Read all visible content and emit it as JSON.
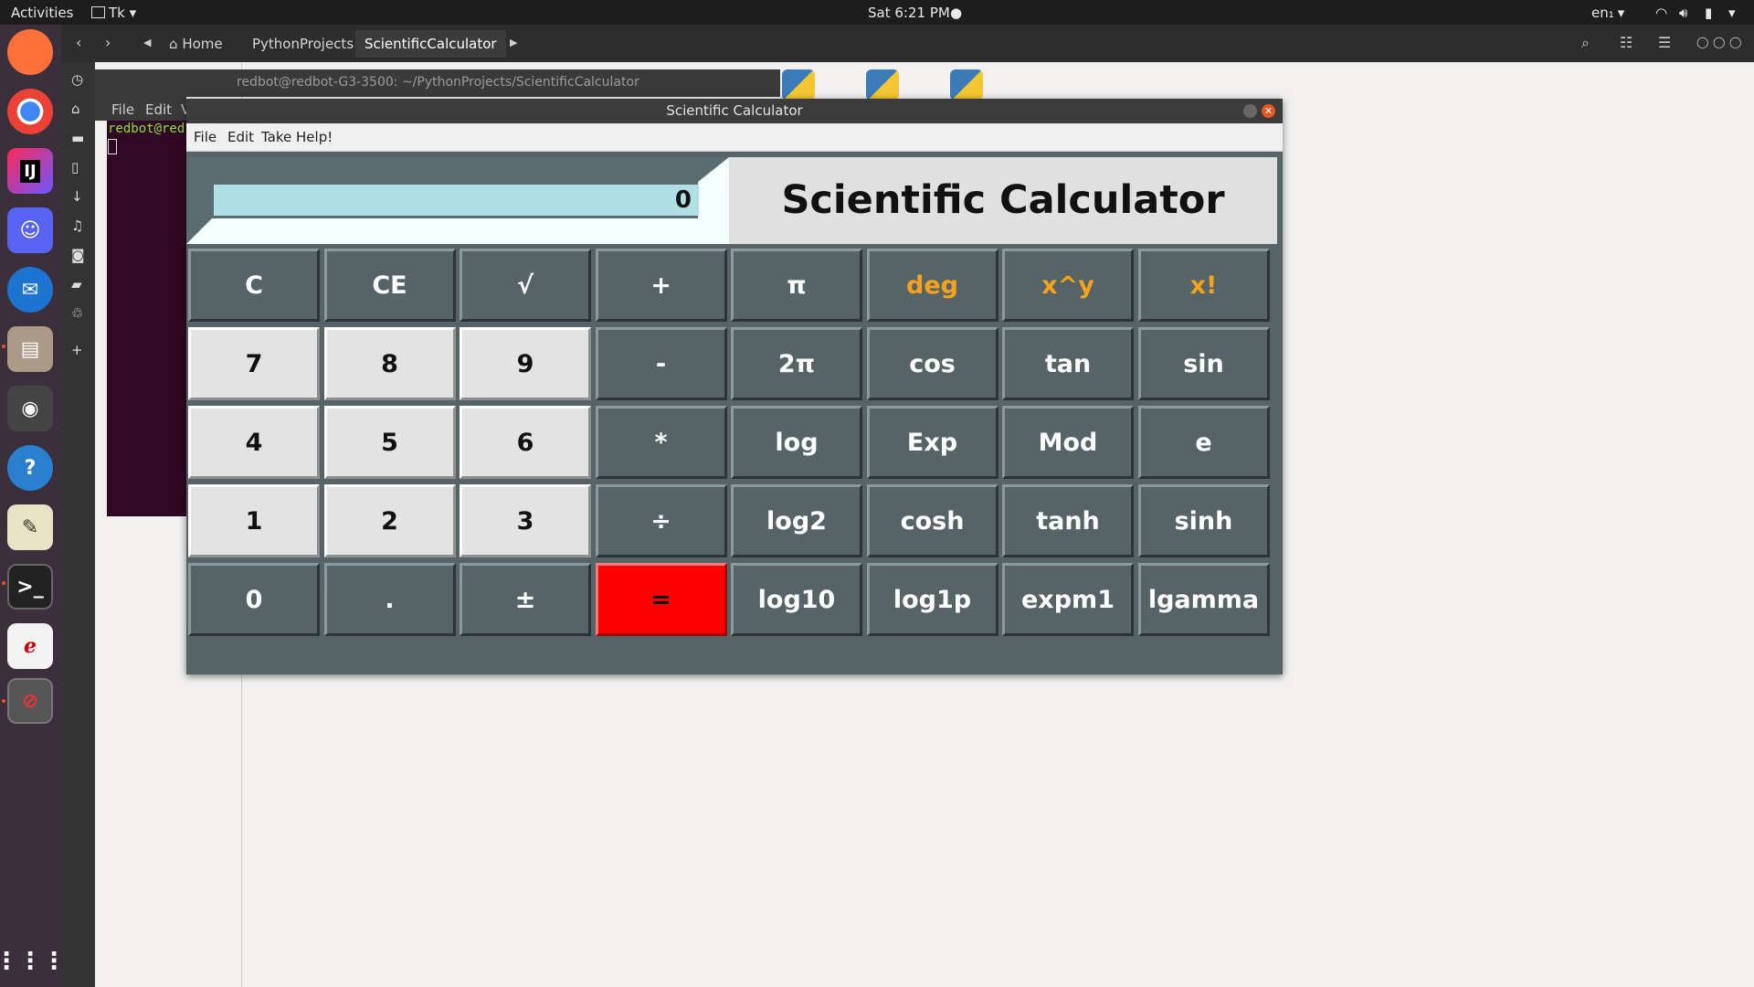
{
  "topbar": {
    "activities": "Activities",
    "app_menu": "Tk",
    "clock": "Sat  6:21 PM",
    "lang": "en₁",
    "lang_arrow": "▾"
  },
  "files": {
    "breadcrumbs": [
      "Home",
      "PythonProjects",
      "ScientificCalculator"
    ]
  },
  "terminal": {
    "title": "redbot@redbot-G3-3500: ~/PythonProjects/ScientificCalculator",
    "menu": [
      "File",
      "Edit",
      "V"
    ],
    "prompt": "redbot@red"
  },
  "calculator": {
    "window_title": "Scientific Calculator",
    "menu": [
      "File",
      "Edit",
      "Take Help!"
    ],
    "display_value": "0",
    "heading": "Scientific Calculator",
    "rows": [
      [
        "C",
        "CE",
        "√",
        "+",
        "π",
        "deg",
        "x^y",
        "x!"
      ],
      [
        "7",
        "8",
        "9",
        "-",
        "2π",
        "cos",
        "tan",
        "sin"
      ],
      [
        "4",
        "5",
        "6",
        "*",
        "log",
        "Exp",
        "Mod",
        "e"
      ],
      [
        "1",
        "2",
        "3",
        "÷",
        "log2",
        "cosh",
        "tanh",
        "sinh"
      ],
      [
        "0",
        ".",
        "±",
        "=",
        "log10",
        "log1p",
        "expm1",
        "lgamma"
      ]
    ]
  },
  "colors": {
    "key_dark": "#566367",
    "key_light": "#e3e3e3",
    "key_orange_text": "#f6a21d",
    "equals_red": "#ff0000",
    "display_bg": "#b0e0e6"
  }
}
